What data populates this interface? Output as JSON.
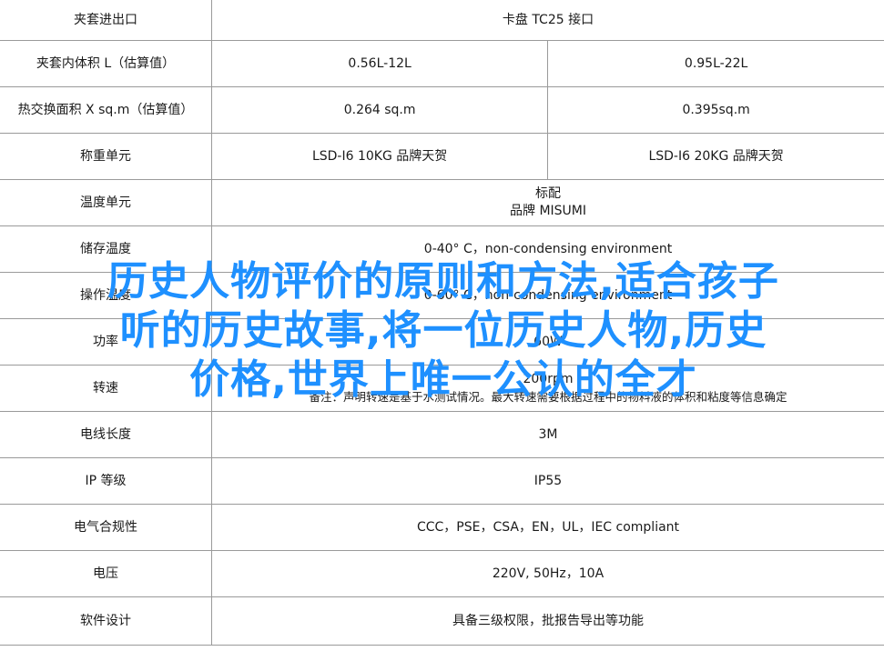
{
  "rows": [
    {
      "label": "夹套进出口",
      "a": "卡盘 TC25 接口"
    },
    {
      "label": "夹套内体积 L（估算值）",
      "a": "0.56L-12L",
      "b": "0.95L-22L"
    },
    {
      "label": "热交换面积 X sq.m（估算值）",
      "a": "0.264 sq.m",
      "b": "0.395sq.m"
    },
    {
      "label": "称重单元",
      "a": "LSD-I6 10KG 品牌天贺",
      "b": "LSD-I6 20KG 品牌天贺"
    },
    {
      "label": "温度单元",
      "a": "标配",
      "a2": "品牌 MISUMI"
    },
    {
      "label": "储存温度",
      "a": "0-40° C，non-condensing environment"
    },
    {
      "label": "操作温度",
      "a": "0-60° C，non-condensing environment"
    },
    {
      "label": "功率",
      "a": "60W"
    },
    {
      "label": "转速",
      "a": "200rpm",
      "note": "备注：声明转速是基于水测试情况。最大转速需要根据过程中的物料液的体积和粘度等信息确定"
    },
    {
      "label": "电线长度",
      "a": "3M"
    },
    {
      "label": "IP 等级",
      "a": "IP55"
    },
    {
      "label": "电气合规性",
      "a": "CCC，PSE，CSA，EN，UL，IEC compliant"
    },
    {
      "label": "电压",
      "a": "220V, 50Hz，10A"
    },
    {
      "label": "软件设计",
      "a": "具备三级权限，批报告导出等功能"
    }
  ],
  "overlay": {
    "line1": "历史人物评价的原则和方法,适合孩子",
    "line2": "听的历史故事,将一位历史人物,历史",
    "line3": "价格,世界上唯一公认的全才",
    "color": "#1e90ff"
  }
}
